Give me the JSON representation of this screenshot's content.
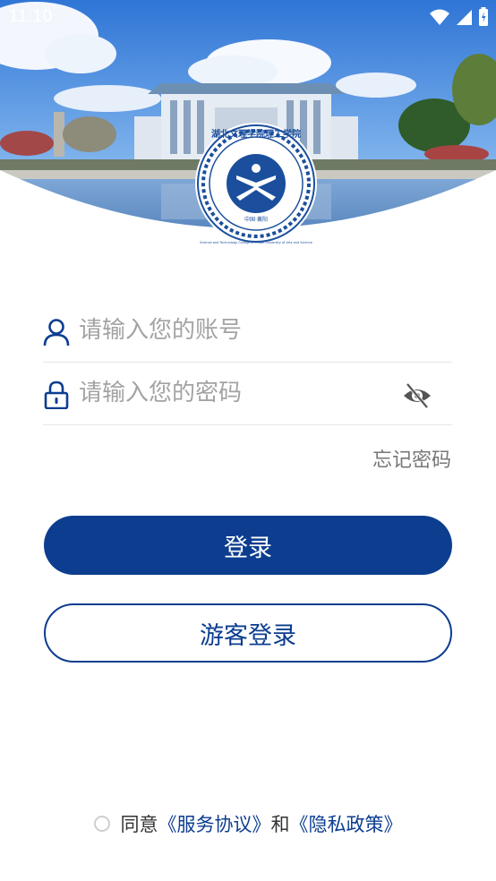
{
  "status_bar": {
    "time": "11:10"
  },
  "logo": {
    "text_top": "湖北文理学院理工学院",
    "text_side": "Science and Technology College of Hubei University of Arts and Science",
    "text_bottom": "中国·襄阳"
  },
  "login": {
    "account_placeholder": "请输入您的账号",
    "password_placeholder": "请输入您的密码",
    "forgot_label": "忘记密码",
    "login_label": "登录",
    "guest_label": "游客登录"
  },
  "agreement": {
    "prefix": "同意",
    "service_link": "《服务协议》",
    "and": "和",
    "privacy_link": "《隐私政策》"
  },
  "colors": {
    "primary": "#0c3d8f",
    "placeholder": "#a3a3a3"
  },
  "icons": [
    "user-icon",
    "lock-icon",
    "eye-off-icon",
    "wifi-icon",
    "signal-icon",
    "battery-icon"
  ]
}
